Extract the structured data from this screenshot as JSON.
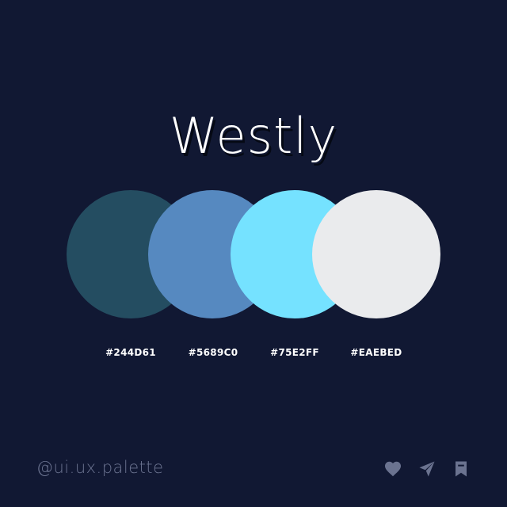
{
  "title": "Westly",
  "swatches": [
    {
      "hex": "#244D61",
      "color": "#244D61"
    },
    {
      "hex": "#5689C0",
      "color": "#5689C0"
    },
    {
      "hex": "#75E2FF",
      "color": "#75E2FF"
    },
    {
      "hex": "#EAEBED",
      "color": "#EAEBED"
    }
  ],
  "handle": "@ui.ux.palette",
  "icons": {
    "like": "heart-icon",
    "share": "send-icon",
    "save": "bookmark-icon",
    "color": "#6b7390"
  },
  "colors": {
    "background": "#111833",
    "text": "#FFFFFF"
  }
}
